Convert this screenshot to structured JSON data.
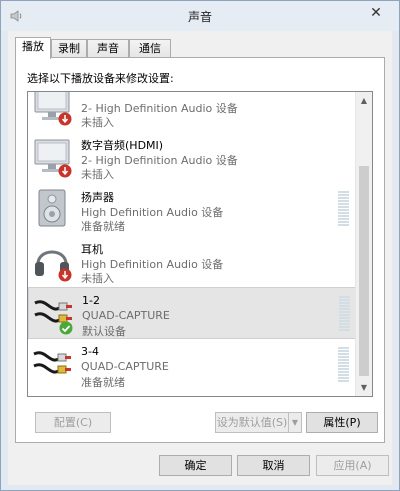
{
  "window": {
    "title": "声音",
    "close_glyph": "✕"
  },
  "tabs": [
    {
      "label": "播放"
    },
    {
      "label": "录制"
    },
    {
      "label": "声音"
    },
    {
      "label": "通信"
    }
  ],
  "instruction": "选择以下播放设备来修改设置:",
  "devices": [
    {
      "name": "",
      "desc": "2- High Definition Audio 设备",
      "status": "未插入",
      "icon": "monitor-icon",
      "badge": "disconnected-icon"
    },
    {
      "name": "数字音频(HDMI)",
      "desc": "2- High Definition Audio 设备",
      "status": "未插入",
      "icon": "monitor-icon",
      "badge": "disconnected-icon"
    },
    {
      "name": "扬声器",
      "desc": "High Definition Audio 设备",
      "status": "准备就绪",
      "icon": "speaker-icon",
      "badge": ""
    },
    {
      "name": "耳机",
      "desc": "High Definition Audio 设备",
      "status": "未插入",
      "icon": "headphones-icon",
      "badge": "disconnected-icon"
    },
    {
      "name": "1-2",
      "desc": "QUAD-CAPTURE",
      "status": "默认设备",
      "icon": "rca-cable-icon",
      "badge": "default-check-icon",
      "selected": true
    },
    {
      "name": "3-4",
      "desc": "QUAD-CAPTURE",
      "status": "准备就绪",
      "icon": "rca-cable-icon",
      "badge": ""
    }
  ],
  "buttons": {
    "configure": "配置(C)",
    "set_default": "设为默认值(S)",
    "properties": "属性(P)",
    "ok": "确定",
    "cancel": "取消",
    "apply": "应用(A)"
  },
  "colors": {
    "accent_check": "#4ba83a",
    "disconnected": "#c8332a",
    "meter": "#d3dde4"
  }
}
